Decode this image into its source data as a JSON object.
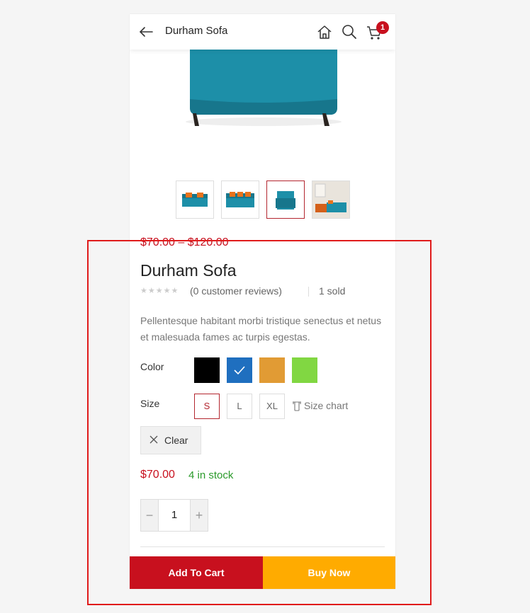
{
  "header": {
    "title": "Durham Sofa",
    "cart_count": "1",
    "icons": [
      "back-arrow-icon",
      "home-icon",
      "search-icon",
      "cart-icon"
    ]
  },
  "gallery": {
    "thumbnails": [
      "sofa-three-seat-front",
      "sofa-three-seat-angle",
      "sofa-chair-side",
      "sofa-room-scene"
    ],
    "active_index": 2
  },
  "product": {
    "price_range": "$70.00 – $120.00",
    "name": "Durham Sofa",
    "rating_stars": "★★★★★",
    "reviews": "(0 customer reviews)",
    "sold": "1 sold",
    "description": "Pellentesque habitant morbi tristique senectus et netus et malesuada fames ac turpis egestas."
  },
  "options": {
    "color_label": "Color",
    "colors": [
      {
        "hex": "#000000",
        "selected": false
      },
      {
        "hex": "#1f6fbf",
        "selected": true
      },
      {
        "hex": "#e19b34",
        "selected": false
      },
      {
        "hex": "#81d742",
        "selected": false
      }
    ],
    "size_label": "Size",
    "sizes": [
      {
        "label": "S",
        "selected": true
      },
      {
        "label": "L",
        "selected": false
      },
      {
        "label": "XL",
        "selected": false
      }
    ],
    "size_chart": "Size chart",
    "clear": "Clear"
  },
  "purchase": {
    "price": "$70.00",
    "stock": "4 in stock",
    "quantity": "1",
    "minus": "−",
    "plus": "+",
    "add_to_cart": "Add To Cart",
    "buy_now": "Buy Now"
  },
  "colors": {
    "accent_red": "#c8101e",
    "buy_now_orange": "#ffab00",
    "stock_green": "#2a9a2a"
  }
}
